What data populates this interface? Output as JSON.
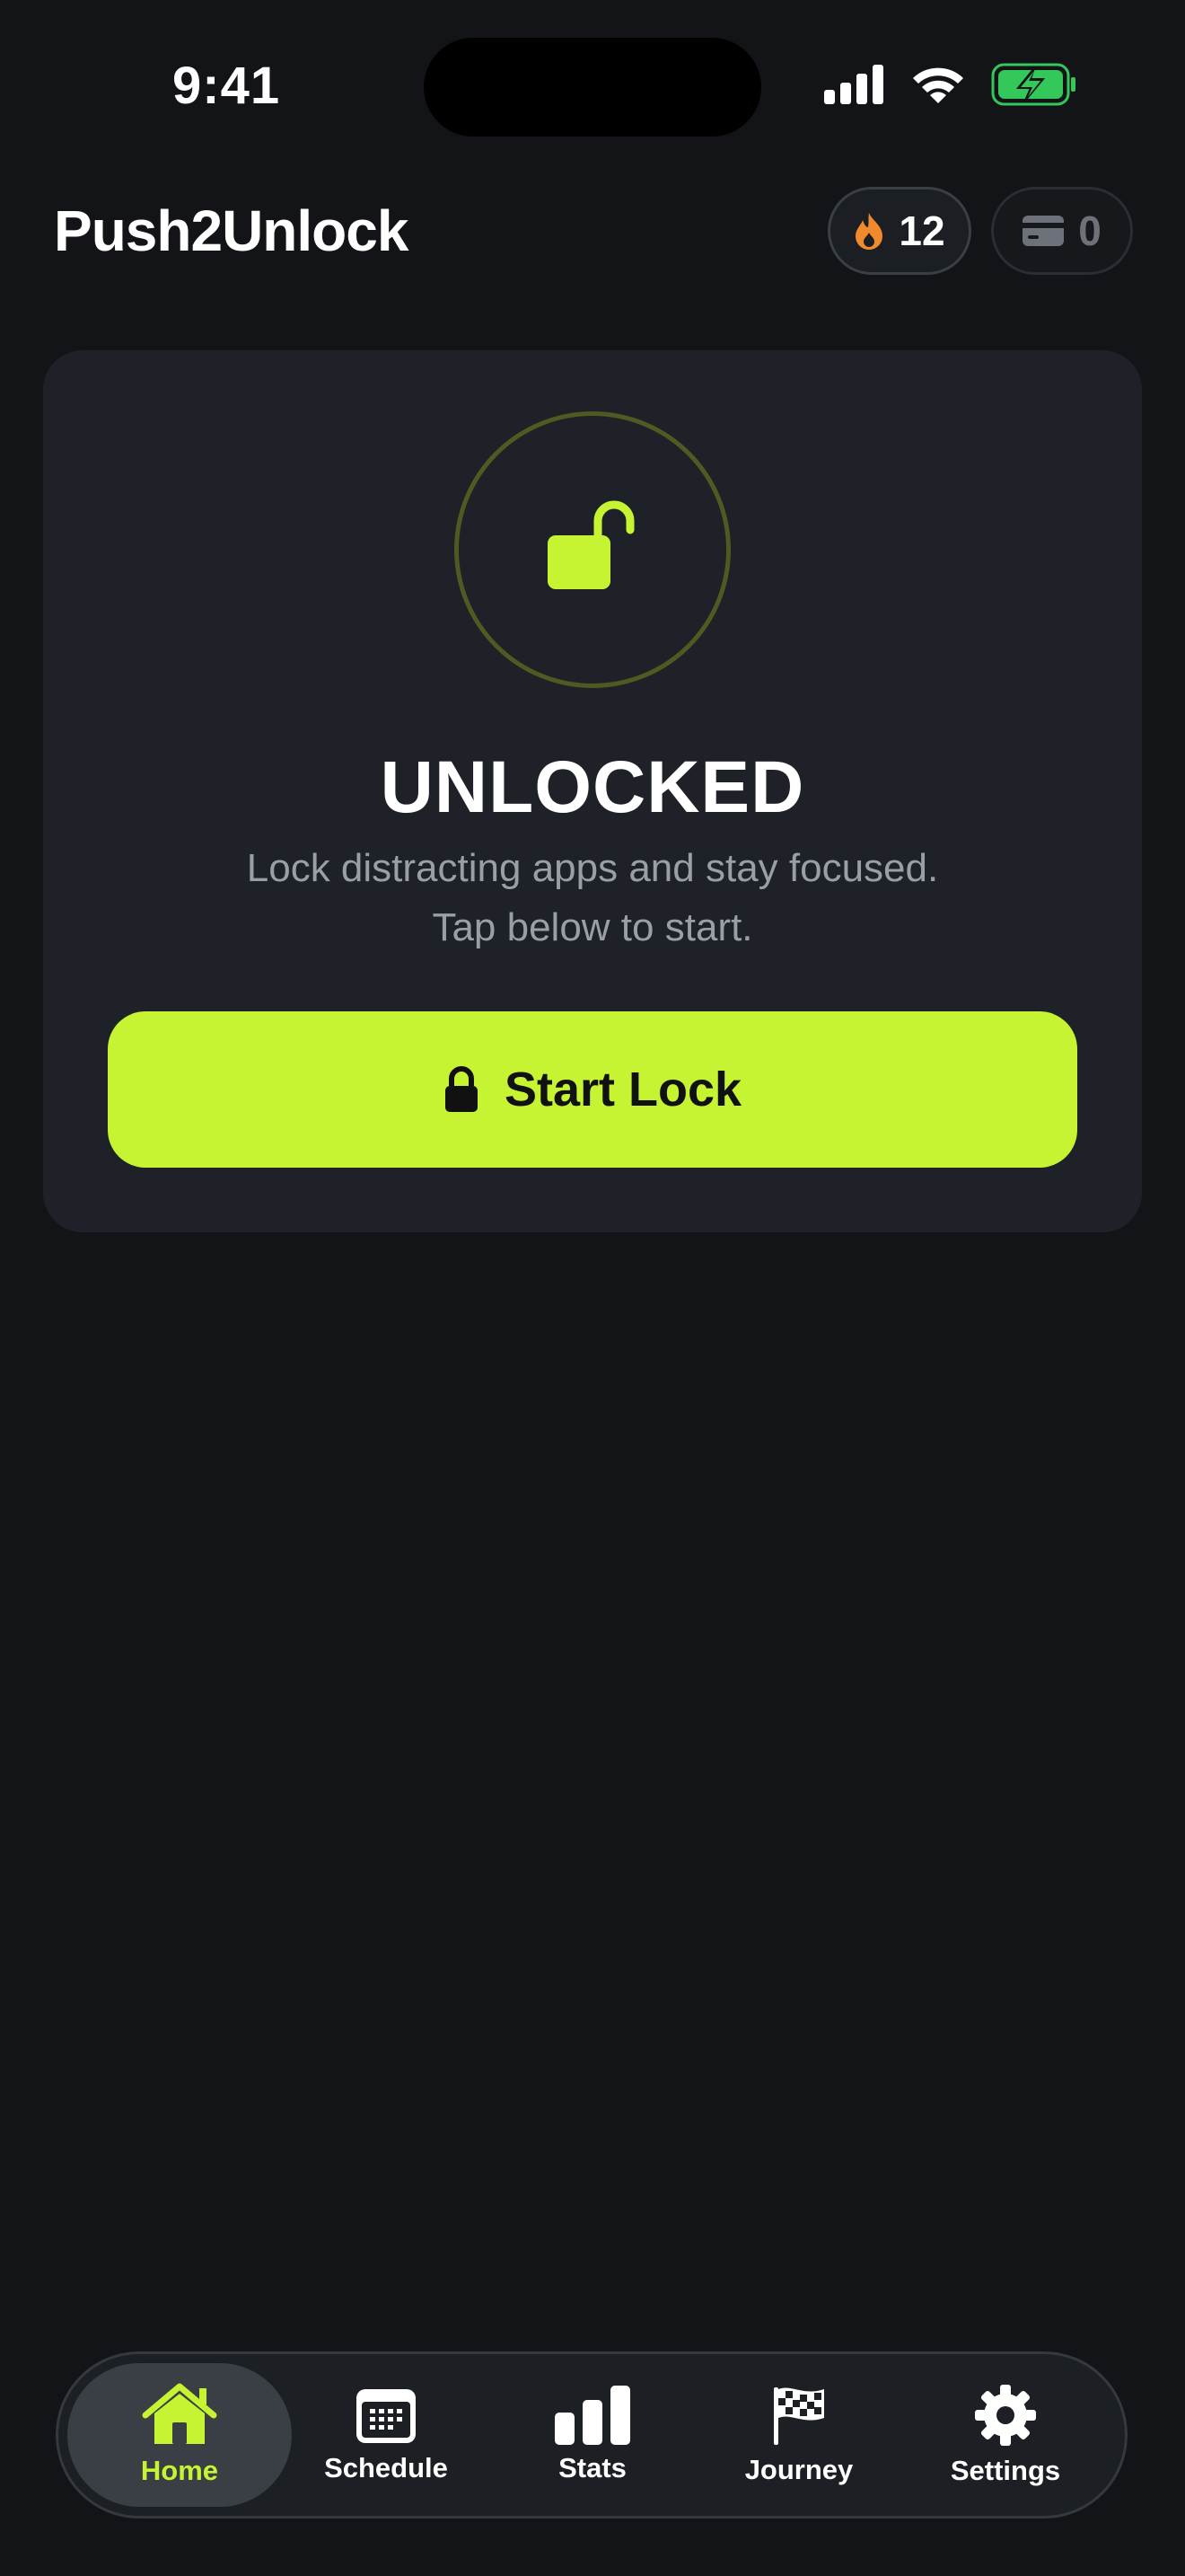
{
  "status_bar": {
    "time": "9:41"
  },
  "header": {
    "title": "Push2Unlock",
    "streak_count": "12",
    "cards_count": "0"
  },
  "lock_card": {
    "status": "UNLOCKED",
    "subtitle_line1": "Lock distracting apps and stay focused.",
    "subtitle_line2": "Tap below to start.",
    "button_label": "Start Lock"
  },
  "tabs": [
    {
      "label": "Home",
      "icon": "house-icon",
      "active": true
    },
    {
      "label": "Schedule",
      "icon": "calendar-icon",
      "active": false
    },
    {
      "label": "Stats",
      "icon": "bar-chart-icon",
      "active": false
    },
    {
      "label": "Journey",
      "icon": "checkered-flag-icon",
      "active": false
    },
    {
      "label": "Settings",
      "icon": "gear-icon",
      "active": false
    }
  ],
  "colors": {
    "accent": "#c6f432",
    "background": "#121418",
    "card": "#1e2127",
    "flame": "#f08a2c",
    "battery": "#34c759"
  }
}
